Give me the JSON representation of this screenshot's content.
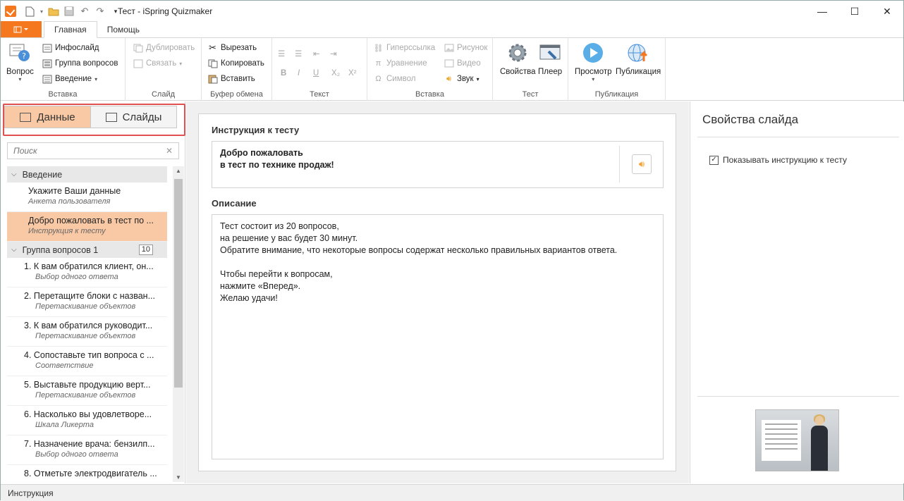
{
  "window": {
    "title": "Тест - iSpring Quizmaker",
    "controls": [
      "minimize-icon",
      "maximize-icon",
      "close-icon"
    ]
  },
  "tabs": {
    "items": [
      {
        "label": "Главная",
        "active": true
      },
      {
        "label": "Помощь",
        "active": false
      }
    ]
  },
  "ribbon": {
    "insert": {
      "group_label": "Вставка",
      "question_label": "Вопрос",
      "infoslide_label": "Инфослайд",
      "question_group_label": "Группа вопросов",
      "intro_label": "Введение"
    },
    "slide": {
      "group_label": "Слайд",
      "duplicate_label": "Дублировать",
      "link_label": "Связать"
    },
    "clipboard": {
      "group_label": "Буфер обмена",
      "cut_label": "Вырезать",
      "copy_label": "Копировать",
      "paste_label": "Вставить"
    },
    "text": {
      "group_label": "Текст",
      "bold": "B",
      "italic": "I",
      "underline": "U",
      "subscript": "X₂",
      "superscript": "X²"
    },
    "insert2": {
      "group_label": "Вставка",
      "hyperlink_label": "Гиперссылка",
      "equation_label": "Уравнение",
      "symbol_label": "Символ",
      "picture_label": "Рисунок",
      "video_label": "Видео",
      "sound_label": "Звук"
    },
    "test": {
      "group_label": "Тест",
      "properties_label": "Свойства",
      "player_label": "Плеер"
    },
    "publish": {
      "group_label": "Публикация",
      "preview_label": "Просмотр",
      "publish_label": "Публикация"
    }
  },
  "left_panel": {
    "segments": {
      "data_label": "Данные",
      "slides_label": "Слайды",
      "active": "data"
    },
    "search": {
      "placeholder": "Поиск"
    },
    "intro_section": {
      "label": "Введение"
    },
    "intro_items": [
      {
        "title": "Укажите Ваши данные",
        "subtitle": "Анкета пользователя",
        "active": false
      },
      {
        "title": "Добро пожаловать в тест по ...",
        "subtitle": "Инструкция к тесту",
        "active": true
      }
    ],
    "group_section": {
      "label": "Группа вопросов 1",
      "count": "10"
    },
    "questions": [
      {
        "title": "1. К вам обратился клиент, он...",
        "subtitle": "Выбор одного ответа"
      },
      {
        "title": "2. Перетащите блоки с назван...",
        "subtitle": "Перетаскивание объектов"
      },
      {
        "title": "3. К вам обратился руководит...",
        "subtitle": "Перетаскивание объектов"
      },
      {
        "title": "4. Сопоставьте тип вопроса с ...",
        "subtitle": "Соответствие"
      },
      {
        "title": "5. Выставьте продукцию верт...",
        "subtitle": "Перетаскивание объектов"
      },
      {
        "title": "6. Насколько вы удовлетворе...",
        "subtitle": "Шкала Ликерта"
      },
      {
        "title": "7. Назначение врача: бензилп...",
        "subtitle": "Выбор одного ответа"
      },
      {
        "title": "8. Отметьте электродвигатель ...",
        "subtitle": ""
      }
    ]
  },
  "editor": {
    "instruction_label": "Инструкция к тесту",
    "instruction_text": "Добро пожаловать\nв тест по технике продаж!",
    "description_label": "Описание",
    "description_text": "Тест состоит из 20 вопросов,\nна решение у вас будет 30 минут.\nОбратите внимание, что некоторые вопросы содержат несколько правильных вариантов ответа.\n\nЧтобы перейти к вопросам,\nнажмите «Вперед».\nЖелаю удачи!"
  },
  "right_panel": {
    "title": "Свойства слайда",
    "show_instruction_label": "Показывать инструкцию к тесту",
    "show_instruction_checked": true
  },
  "status_bar": {
    "text": "Инструкция"
  },
  "colors": {
    "accent": "#f5781e",
    "selection": "#f9c9a5",
    "highlight_border": "#e05050"
  }
}
